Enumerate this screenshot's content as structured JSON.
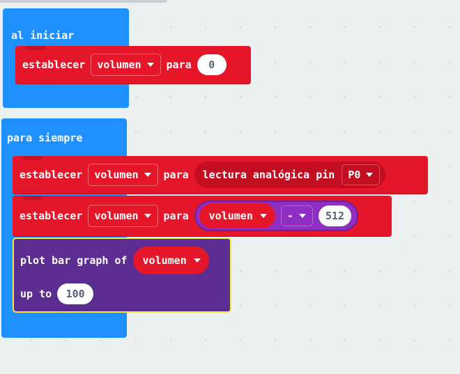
{
  "on_start": {
    "label": "al iniciar",
    "set_block": {
      "keyword": "establecer",
      "variable": "volumen",
      "to": "para",
      "value": "0"
    }
  },
  "forever": {
    "label": "para siempre",
    "set_analog": {
      "keyword": "establecer",
      "variable": "volumen",
      "to": "para",
      "reporter_label": "lectura analógica pin",
      "pin": "P0"
    },
    "set_math": {
      "keyword": "establecer",
      "variable": "volumen",
      "to": "para",
      "operand_variable": "volumen",
      "operator": "-",
      "operand_value": "512"
    },
    "plot": {
      "label": "plot bar graph of",
      "variable": "volumen",
      "up_to_label": "up to",
      "up_to_value": "100"
    }
  },
  "colors": {
    "workspace": "#ecf0f1",
    "event_block": "#1e90ff",
    "variable_block": "#e6162a",
    "math_block": "#8e2ec2",
    "led_block": "#5c2d91",
    "highlight_outline": "#f3e84a"
  },
  "icons": {
    "dropdown": "caret-down-icon"
  }
}
